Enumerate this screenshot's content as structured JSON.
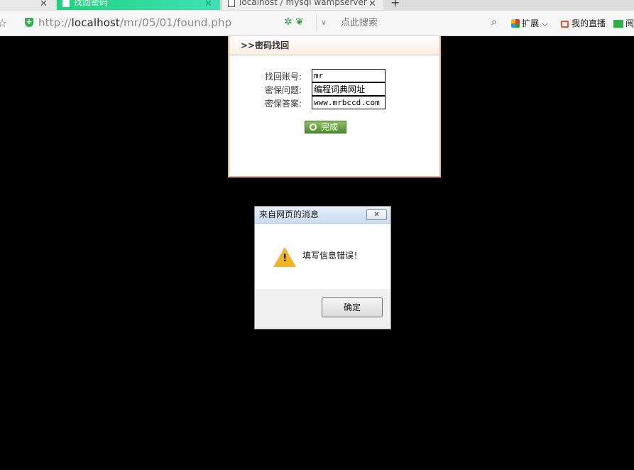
{
  "tabs": [
    {
      "title": "",
      "close": "✕"
    },
    {
      "title": "找回密码",
      "close": "✕"
    },
    {
      "title": "localhost / mysql wampserver",
      "close": "✕"
    }
  ],
  "new_tab_label": "+",
  "address": {
    "scheme": "http://",
    "host": "localhost",
    "path": "/mr/05/01/found.php"
  },
  "search": {
    "placeholder": "点此搜索"
  },
  "toolbar": {
    "extensions": "扩展",
    "extensions_chevron": "⌵",
    "live": "我的直播",
    "reader": "阅"
  },
  "panel": {
    "title": ">>密码找回",
    "fields": [
      {
        "label": "找回账号:",
        "value": "mr"
      },
      {
        "label": "密保问题:",
        "value": "编程词典网址"
      },
      {
        "label": "密保答案:",
        "value": "www.mrbccd.com"
      }
    ],
    "submit_label": "完成"
  },
  "dialog": {
    "title": "来自网页的消息",
    "close": "✕",
    "message": "填写信息错误！",
    "ok_label": "确定"
  },
  "colors": {
    "tab_active": "#1fd37d",
    "panel_border": "#e9b88f",
    "button_green": "#4f8a2e",
    "warning": "#f2b51f"
  }
}
